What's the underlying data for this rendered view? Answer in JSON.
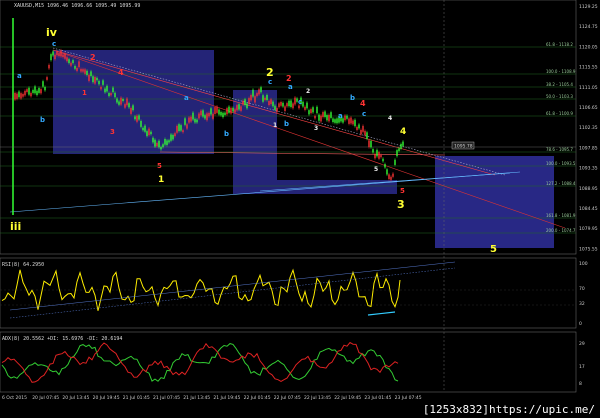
{
  "main": {
    "header": "XAUUSD,M15 1096.46 1096.66 1095.49 1095.99",
    "price_axis": [
      "1129.25",
      "1124.75",
      "1120.05",
      "1115.55",
      "1111.05",
      "1106.65",
      "1102.35",
      "1097.85",
      "1093.35",
      "1088.95",
      "1084.45",
      "1079.95",
      "1075.55"
    ],
    "price_box_label": "1095.78",
    "fib_labels": [
      "61.8 - 1118.2",
      "100.0 - 1108.9",
      "38.2 - 1105.4",
      "50.0 - 1103.3",
      "61.8 - 1100.9",
      "78.6 - 1095.7",
      "100.0 - 1093.5",
      "127.2 - 1088.4",
      "161.8 - 1081.9",
      "200.0 - 1074.7"
    ],
    "wave_labels": [
      {
        "t": "iv",
        "c": "#ffff33"
      },
      {
        "t": "iii",
        "c": "#ffff33"
      },
      {
        "t": "2",
        "c": "#ffff33"
      },
      {
        "t": "1",
        "c": "#ffff33"
      },
      {
        "t": "4",
        "c": "#ffff33"
      },
      {
        "t": "3",
        "c": "#ffff33"
      },
      {
        "t": "5",
        "c": "#ffff33"
      },
      {
        "t": "2",
        "c": "#ff3333"
      },
      {
        "t": "4",
        "c": "#ff3333"
      },
      {
        "t": "1",
        "c": "#ff3333"
      },
      {
        "t": "3",
        "c": "#ff3333"
      },
      {
        "t": "5",
        "c": "#ff3333"
      },
      {
        "t": "2",
        "c": "#ff3333"
      },
      {
        "t": "4",
        "c": "#ff3333"
      },
      {
        "t": "5",
        "c": "#ff3333"
      },
      {
        "t": "a",
        "c": "#33aaff"
      },
      {
        "t": "b",
        "c": "#33aaff"
      },
      {
        "t": "c",
        "c": "#33aaff"
      },
      {
        "t": "a",
        "c": "#33aaff"
      },
      {
        "t": "b",
        "c": "#33aaff"
      },
      {
        "t": "c",
        "c": "#33aaff"
      },
      {
        "t": "a",
        "c": "#33aaff"
      },
      {
        "t": "b",
        "c": "#33aaff"
      },
      {
        "t": "c",
        "c": "#33aaff"
      },
      {
        "t": "a",
        "c": "#33aaff"
      },
      {
        "t": "b",
        "c": "#33aaff"
      },
      {
        "t": "c",
        "c": "#33aaff"
      },
      {
        "t": "1",
        "c": "#eeeeee"
      },
      {
        "t": "2",
        "c": "#eeeeee"
      },
      {
        "t": "3",
        "c": "#eeeeee"
      },
      {
        "t": "4",
        "c": "#eeeeee"
      },
      {
        "t": "5",
        "c": "#eeeeee"
      }
    ]
  },
  "rsi": {
    "label": "RSI(8) 64.2950",
    "axis": [
      "100",
      "70",
      "32",
      "0"
    ]
  },
  "adx": {
    "label": "ADX(8) 20.5562 +DI: 15.6976 -DI: 20.6194",
    "axis": [
      "29",
      "17",
      "8"
    ]
  },
  "time_axis": [
    "6 Oct 2015",
    "20 Jul 07:45",
    "20 Jul 13:45",
    "20 Jul 19:45",
    "21 Jul 01:45",
    "21 Jul 07:45",
    "21 Jul 13:45",
    "21 Jul 19:45",
    "22 Jul 01:45",
    "22 Jul 07:45",
    "22 Jul 13:45",
    "22 Jul 19:45",
    "23 Jul 01:45",
    "23 Jul 07:45"
  ],
  "watermark": "[1253x832]https://upic.me/",
  "colors": {
    "bull": "#33ff33",
    "bear": "#ff3333",
    "box": "#2a2a8c",
    "rsi": "#ffee00",
    "plus_di": "#33cc33",
    "minus_di": "#dd2222",
    "trend": "#aaaacc"
  }
}
